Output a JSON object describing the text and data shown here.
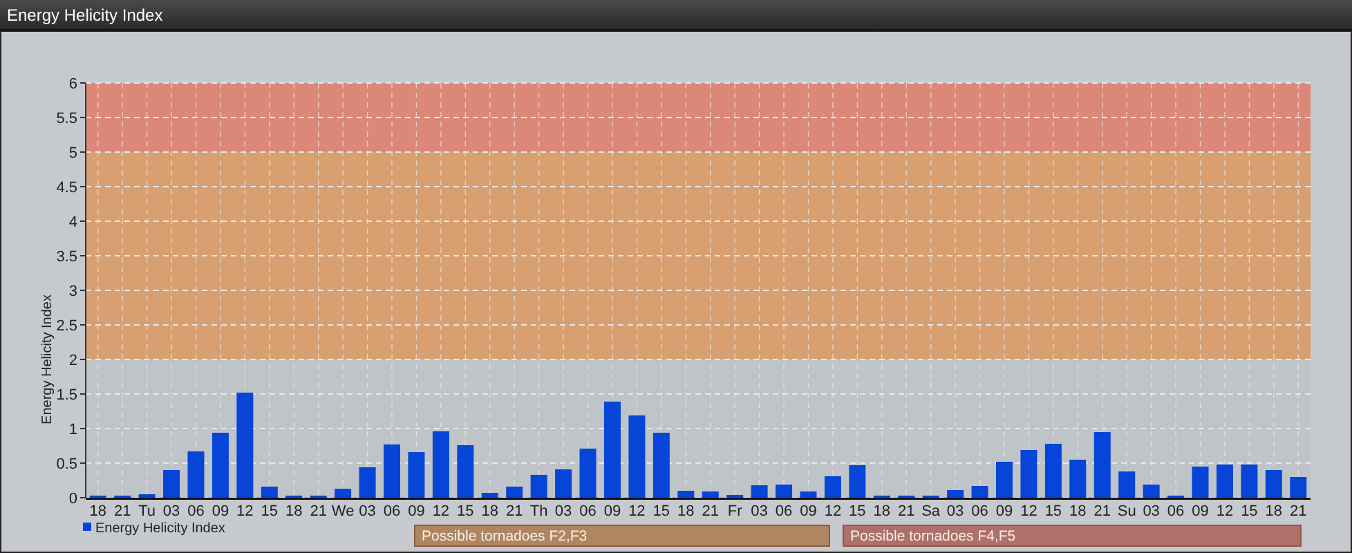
{
  "window": {
    "title": "Energy Helicity Index"
  },
  "chart_data": {
    "type": "bar",
    "ylabel": "Energy Helicity Index",
    "categories": [
      "18",
      "21",
      "Tu",
      "03",
      "06",
      "09",
      "12",
      "15",
      "18",
      "21",
      "We",
      "03",
      "06",
      "09",
      "12",
      "15",
      "18",
      "21",
      "Th",
      "03",
      "06",
      "09",
      "12",
      "15",
      "18",
      "21",
      "Fr",
      "03",
      "06",
      "09",
      "12",
      "15",
      "18",
      "21",
      "Sa",
      "03",
      "06",
      "09",
      "12",
      "15",
      "18",
      "21",
      "Su",
      "03",
      "06",
      "09",
      "12",
      "15",
      "18",
      "21"
    ],
    "series": [
      {
        "name": "Energy Helicity Index",
        "color": "#0645d8",
        "values": [
          0.03,
          0.02,
          0.05,
          0.4,
          0.67,
          0.94,
          1.52,
          0.16,
          0.02,
          0.02,
          0.13,
          0.44,
          0.77,
          0.66,
          0.96,
          0.76,
          0.07,
          0.16,
          0.33,
          0.41,
          0.71,
          1.39,
          1.19,
          0.94,
          0.1,
          0.09,
          0.04,
          0.18,
          0.19,
          0.09,
          0.31,
          0.47,
          0.03,
          0.03,
          0.02,
          0.11,
          0.17,
          0.52,
          0.69,
          0.78,
          0.55,
          0.95,
          0.38,
          0.19,
          0.02,
          0.45,
          0.48,
          0.48,
          0.4,
          0.3
        ]
      }
    ],
    "ylim": [
      0,
      6
    ],
    "yticks": [
      0,
      0.5,
      1,
      1.5,
      2,
      2.5,
      3,
      3.5,
      4,
      4.5,
      5,
      5.5,
      6
    ],
    "grid": true,
    "bands": [
      {
        "axis": "y",
        "from": 2,
        "to": 5,
        "color": "#d8a070"
      },
      {
        "axis": "y",
        "from": 5,
        "to": 6,
        "color": "#dc8878"
      }
    ]
  },
  "risk_labels": [
    {
      "text": "Possible tornadoes F2,F3",
      "color": "#b08662"
    },
    {
      "text": "Possible tornadoes F4,F5",
      "color": "#b0706a"
    }
  ]
}
